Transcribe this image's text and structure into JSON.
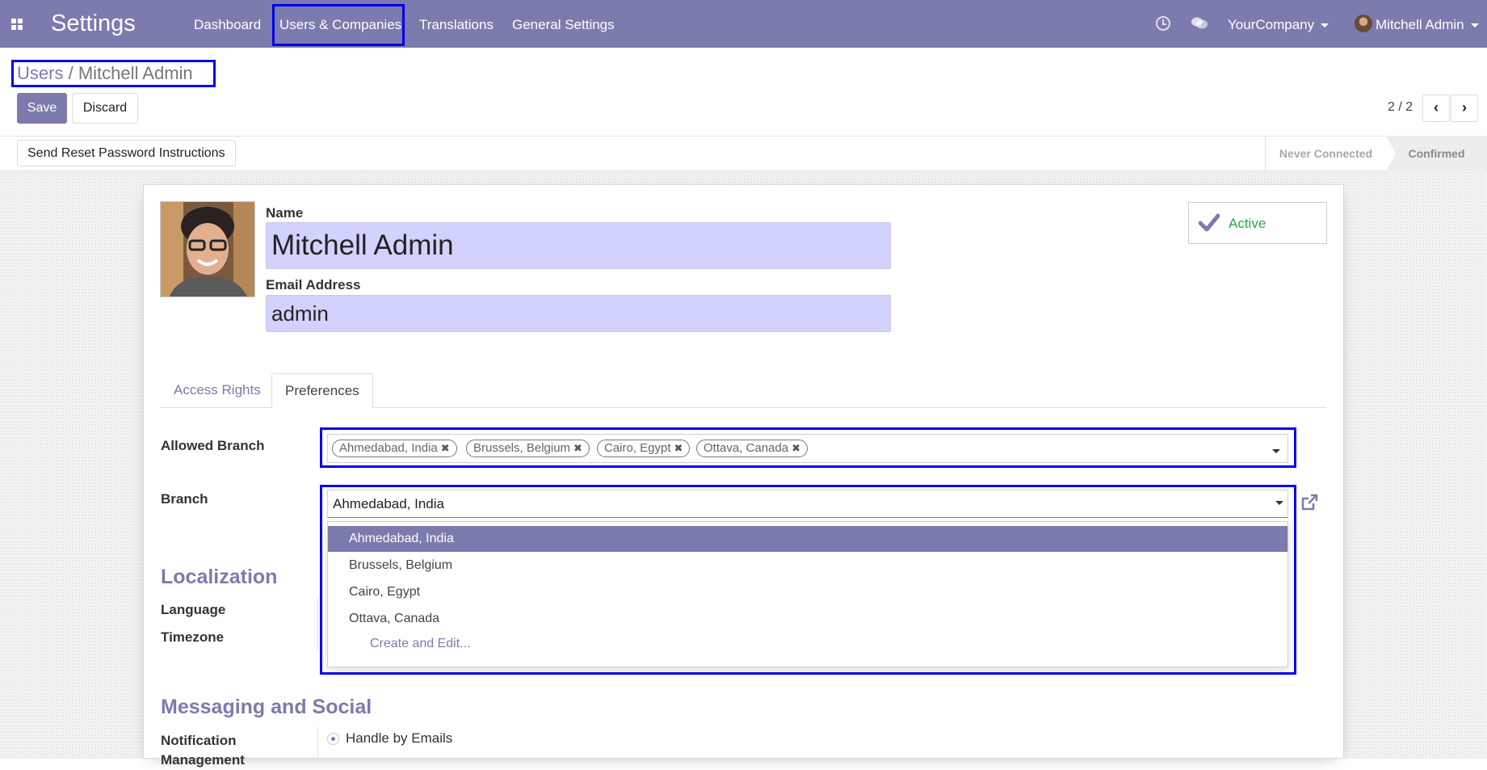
{
  "app": {
    "title": "Settings"
  },
  "nav": {
    "items": [
      {
        "label": "Dashboard"
      },
      {
        "label": "Users & Companies"
      },
      {
        "label": "Translations"
      },
      {
        "label": "General Settings"
      }
    ],
    "company": "YourCompany",
    "user": "Mitchell Admin"
  },
  "breadcrumb": {
    "parent": "Users",
    "separator": "/",
    "current": "Mitchell Admin"
  },
  "actions": {
    "save": "Save",
    "discard": "Discard"
  },
  "pager": {
    "text": "2 / 2"
  },
  "status": {
    "reset_button": "Send Reset Password Instructions",
    "stages": [
      "Never Connected",
      "Confirmed"
    ],
    "current_stage": "Confirmed"
  },
  "form": {
    "name_label": "Name",
    "name_value": "Mitchell Admin",
    "email_label": "Email Address",
    "email_value": "admin",
    "active_label": "Active",
    "active": true
  },
  "tabs": [
    {
      "label": "Access Rights",
      "active": false
    },
    {
      "label": "Preferences",
      "active": true
    }
  ],
  "preferences": {
    "allowed_branch_label": "Allowed Branch",
    "allowed_branches": [
      "Ahmedabad, India",
      "Brussels, Belgium",
      "Cairo, Egypt",
      "Ottava, Canada"
    ],
    "branch_label": "Branch",
    "branch_value": "Ahmedabad, India",
    "branch_options": [
      "Ahmedabad, India",
      "Brussels, Belgium",
      "Cairo, Egypt",
      "Ottava, Canada"
    ],
    "branch_selected": "Ahmedabad, India",
    "create_edit": "Create and Edit..."
  },
  "localization": {
    "title": "Localization",
    "language_label": "Language",
    "timezone_label": "Timezone"
  },
  "messaging": {
    "title": "Messaging and Social",
    "notification_label": "Notification Management",
    "notification_value": "Handle by Emails"
  },
  "colors": {
    "brand": "#7c7bad",
    "highlight": "#0000ee",
    "field_bg": "#d2d2ff",
    "active_green": "#28a745"
  },
  "icons": [
    "apps-icon",
    "clock-icon",
    "chat-icon",
    "caret-down-icon",
    "check-icon",
    "remove-tag-icon",
    "external-link-icon",
    "chevron-left-icon",
    "chevron-right-icon",
    "radio-icon"
  ]
}
